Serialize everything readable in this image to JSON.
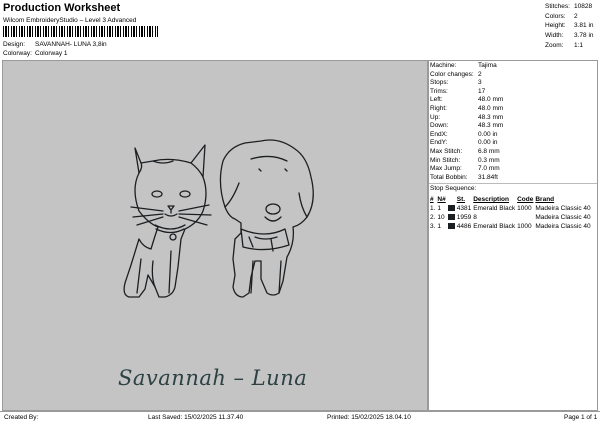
{
  "header": {
    "title": "Production Worksheet",
    "subtitle": "Wilcom EmbroideryStudio – Level 3 Advanced",
    "barcode_suffix": ",",
    "design_label": "Design:",
    "design_value": "SAVANNAH- LUNA 3,8in",
    "colorway_label": "Colorway:",
    "colorway_value": "Colorway 1"
  },
  "stats": [
    {
      "label": "Stitches:",
      "value": "10828"
    },
    {
      "label": "Colors:",
      "value": "2"
    },
    {
      "label": "Height:",
      "value": "3.81 in"
    },
    {
      "label": "Width:",
      "value": "3.78 in"
    },
    {
      "label": "Zoom:",
      "value": "1:1"
    }
  ],
  "design": {
    "embroidered_text": "Savannah – Luna",
    "thread_color": "#2d4143",
    "outline_color": "#1c1f22",
    "background": "#c4c4c4"
  },
  "machine_info": [
    {
      "label": "Machine:",
      "value": "Tajima"
    },
    {
      "label": "Color changes:",
      "value": "2"
    },
    {
      "label": "Stops:",
      "value": "3"
    },
    {
      "label": "Trims:",
      "value": "17"
    },
    {
      "label": "Left:",
      "value": "48.0 mm"
    },
    {
      "label": "Right:",
      "value": "48.0 mm"
    },
    {
      "label": "Up:",
      "value": "48.3 mm"
    },
    {
      "label": "Down:",
      "value": "48.3 mm"
    },
    {
      "label": "EndX:",
      "value": "0.00 in"
    },
    {
      "label": "EndY:",
      "value": "0.00 in"
    },
    {
      "label": "Max Stitch:",
      "value": "6.8 mm"
    },
    {
      "label": "Min Stitch:",
      "value": "0.3 mm"
    },
    {
      "label": "Max Jump:",
      "value": "7.0 mm"
    },
    {
      "label": "Total Bobbin:",
      "value": "31.84ft"
    }
  ],
  "stop_sequence": {
    "title": "Stop Sequence:",
    "headers": [
      "#",
      "N#",
      "St.",
      "Description",
      "Code",
      "Brand"
    ],
    "rows": [
      {
        "num": "1.",
        "n": "1",
        "st": "4381",
        "desc": "Emerald Black",
        "code": "1000",
        "brand": "Madeira Classic 40",
        "color": "#1c1f22"
      },
      {
        "num": "2.",
        "n": "10",
        "st": "1959",
        "desc": "8",
        "code": "",
        "brand": "Madeira Classic 40",
        "color": "#1c1f22"
      },
      {
        "num": "3.",
        "n": "1",
        "st": "4486",
        "desc": "Emerald Black",
        "code": "1000",
        "brand": "Madeira Classic 40",
        "color": "#1c1f22"
      }
    ]
  },
  "footer": {
    "created_by": "Created By:",
    "last_saved": "Last Saved: 15/02/2025 11.37.40",
    "printed": "Printed: 15/02/2025 18.04.10",
    "page": "Page 1 of 1"
  }
}
